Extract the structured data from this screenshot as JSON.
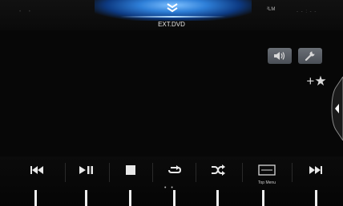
{
  "header": {
    "source_label": "EXT.DVD",
    "signal_indicator": "²LM",
    "clock_text": "- - : - -",
    "left_dots": "• •"
  },
  "side_controls": {
    "audio_icon": "speaker-waves-icon",
    "settings_icon": "wrench-icon",
    "favorite_icon": "star-add-icon",
    "panel_tab_icon": "chevron-left-icon"
  },
  "controls": [
    {
      "name": "previous-track-button",
      "icon": "skip-previous-icon"
    },
    {
      "name": "play-pause-button",
      "icon": "play-pause-icon"
    },
    {
      "name": "stop-button",
      "icon": "stop-icon"
    },
    {
      "name": "repeat-button",
      "icon": "repeat-icon"
    },
    {
      "name": "shuffle-button",
      "icon": "shuffle-icon"
    },
    {
      "name": "top-menu-button",
      "icon": "menu-screen-icon",
      "label": "Top Menu"
    },
    {
      "name": "next-track-button",
      "icon": "skip-next-icon"
    }
  ],
  "repeat_dots": "• •",
  "colors": {
    "background": "#070707",
    "top_glow": "#2e7fd8",
    "side_button": "#5a5f66",
    "icon": "#e8e8e8",
    "tick": "#ededed"
  }
}
